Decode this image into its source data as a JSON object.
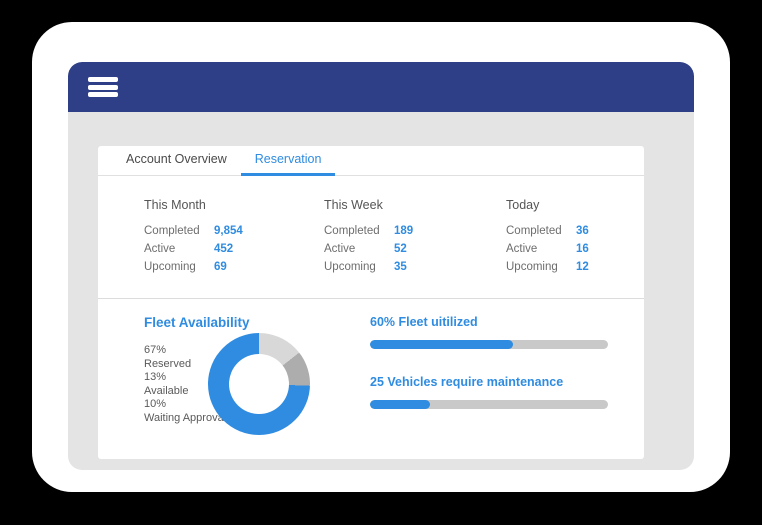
{
  "app": {
    "menu_icon": "hamburger-menu-icon"
  },
  "tabs": [
    {
      "label": "Account Overview",
      "active": false
    },
    {
      "label": "Reservation",
      "active": true
    }
  ],
  "stats": [
    {
      "title": "This Month",
      "rows": [
        {
          "label": "Completed",
          "value": "9,854"
        },
        {
          "label": "Active",
          "value": "452"
        },
        {
          "label": "Upcoming",
          "value": "69"
        }
      ]
    },
    {
      "title": "This Week",
      "rows": [
        {
          "label": "Completed",
          "value": "189"
        },
        {
          "label": "Active",
          "value": "52"
        },
        {
          "label": "Upcoming",
          "value": "35"
        }
      ]
    },
    {
      "title": "Today",
      "rows": [
        {
          "label": "Completed",
          "value": "36"
        },
        {
          "label": "Active",
          "value": "16"
        },
        {
          "label": "Upcoming",
          "value": "12"
        }
      ]
    }
  ],
  "fleet": {
    "title": "Fleet Availability",
    "legend_text": "67%\nReserved\n13%\nAvailable\n10%\nWaiting Approval"
  },
  "progress": [
    {
      "label": "60% Fleet uitilized",
      "percent": 60
    },
    {
      "label": "25 Vehicles require maintenance",
      "percent": 25
    }
  ],
  "colors": {
    "navy": "#2e3f88",
    "accent_blue": "#2f8ce0",
    "page_bg": "#e4e4e4",
    "track_gray": "#c9c9c9",
    "donut_light_gray": "#d8d8d8",
    "donut_mid_gray": "#adadad"
  },
  "chart_data": {
    "type": "pie",
    "title": "Fleet Availability",
    "categories": [
      "Reserved",
      "Available",
      "Waiting Approval"
    ],
    "values": [
      67,
      13,
      10
    ],
    "unit": "%",
    "colors": [
      "#2f8ce0",
      "#d8d8d8",
      "#adadad"
    ],
    "legend_position": "left",
    "donut": true
  }
}
